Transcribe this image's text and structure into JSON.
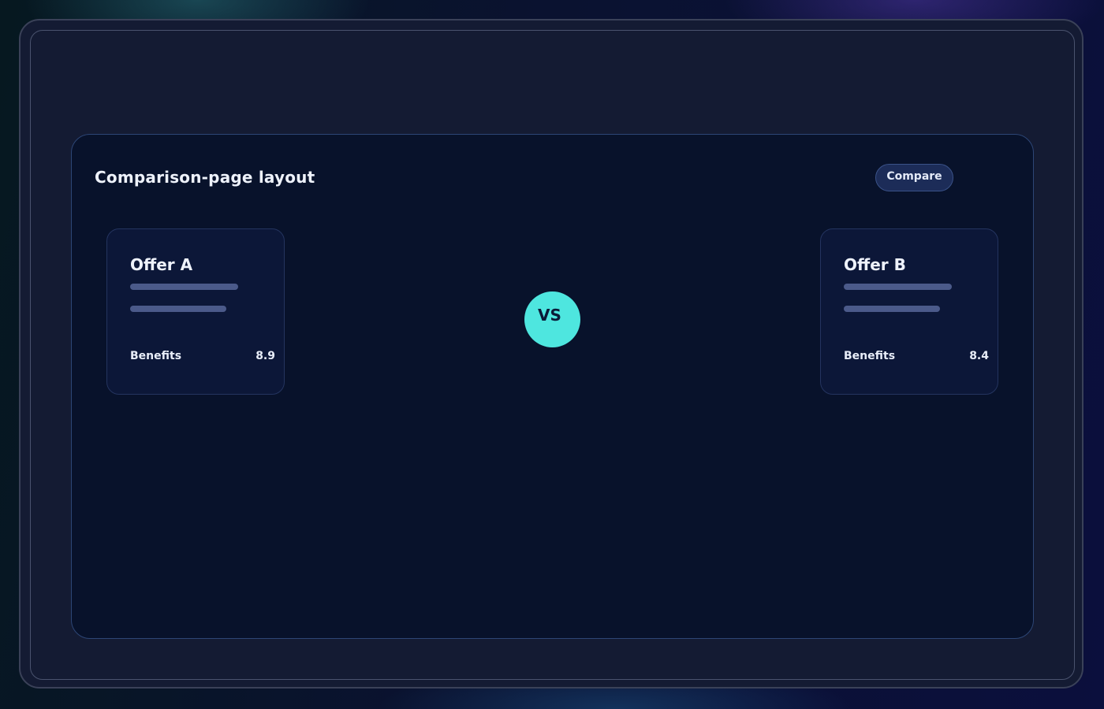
{
  "panel": {
    "title": "Comparison-page layout",
    "compare_button_label": "Compare"
  },
  "offers": [
    {
      "title": "Offer A",
      "metric_label": "Benefits",
      "metric_value": "8.9"
    },
    {
      "title": "Offer B",
      "metric_label": "Benefits",
      "metric_value": "8.4"
    }
  ],
  "vs_label": "VS",
  "colors": {
    "accent": "#4ee6df",
    "panel_bg": "#08122b",
    "card_bg": "#0c1738",
    "placeholder_line": "#4b5a8a"
  }
}
